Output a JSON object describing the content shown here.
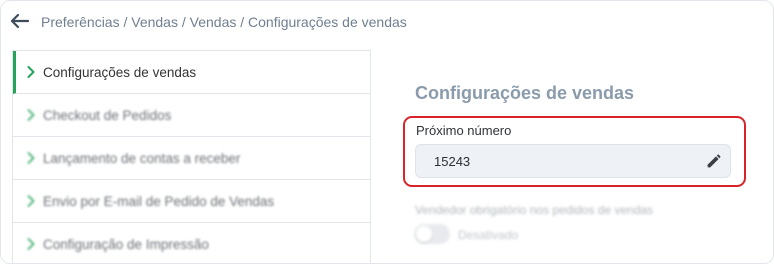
{
  "breadcrumb": "Preferências / Vendas / Vendas / Configurações de vendas",
  "menu": {
    "items": [
      {
        "label": "Configurações de vendas",
        "active": true
      },
      {
        "label": "Checkout de Pedidos",
        "active": false
      },
      {
        "label": "Lançamento de contas a receber",
        "active": false
      },
      {
        "label": "Envio por E-mail de Pedido de Vendas",
        "active": false
      },
      {
        "label": "Configuração de Impressão",
        "active": false
      }
    ]
  },
  "panel": {
    "title": "Configurações de vendas",
    "next_number": {
      "label": "Próximo número",
      "value": "15243"
    },
    "seller_required": {
      "label": "Vendedor obrigatório nos pedidos de vendas",
      "status": "Desativado",
      "enabled": false
    }
  },
  "colors": {
    "accent": "#25a35a",
    "highlight": "#d8232a",
    "title": "#8a9bab"
  },
  "icons": {
    "back": "arrow-left-icon",
    "menu_chevron": "chevron-right-icon",
    "edit": "pencil-icon"
  }
}
